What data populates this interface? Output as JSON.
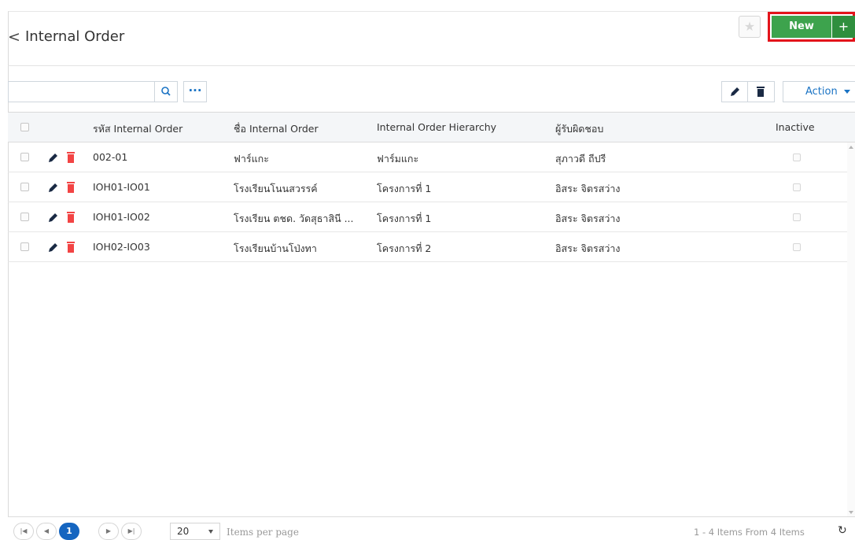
{
  "header": {
    "title": "Internal Order",
    "new_label": "New",
    "new_plus": "+"
  },
  "toolbar": {
    "search_value": "",
    "action_label": "Action"
  },
  "grid": {
    "columns": {
      "code": "รหัส Internal Order",
      "name": "ชื่อ Internal Order",
      "hierarchy": "Internal Order Hierarchy",
      "owner": "ผู้รับผิดชอบ",
      "inactive": "Inactive"
    },
    "rows": [
      {
        "code": "002-01",
        "name": "ฟาร์แกะ",
        "hierarchy": "ฟาร์มแกะ",
        "owner": "สุภาวดี ถีปรี"
      },
      {
        "code": "IOH01-IO01",
        "name": "โรงเรียนโนนสวรรค์",
        "hierarchy": "โครงการที่ 1",
        "owner": "อิสระ จิตรสว่าง"
      },
      {
        "code": "IOH01-IO02",
        "name": "โรงเรียน ตชด. วัดสุธาสินี ...",
        "hierarchy": "โครงการที่ 1",
        "owner": "อิสระ จิตรสว่าง"
      },
      {
        "code": "IOH02-IO03",
        "name": "โรงเรียนบ้านโป่งทา",
        "hierarchy": "โครงการที่ 2",
        "owner": "อิสระ จิตรสว่าง"
      }
    ]
  },
  "pager": {
    "current_page": "1",
    "page_size": "20",
    "items_per_page_label": "Items per page",
    "range_info": "1 - 4 Items From 4 Items"
  },
  "colors": {
    "accent_blue": "#1a73c4",
    "new_green": "#3da34d",
    "delete_red": "#f24444",
    "highlight_red": "#e3141b"
  }
}
